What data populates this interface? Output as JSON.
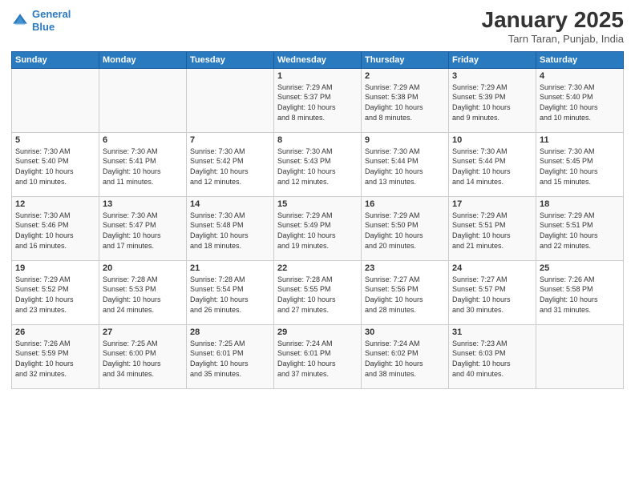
{
  "logo": {
    "line1": "General",
    "line2": "Blue"
  },
  "title": "January 2025",
  "subtitle": "Tarn Taran, Punjab, India",
  "headers": [
    "Sunday",
    "Monday",
    "Tuesday",
    "Wednesday",
    "Thursday",
    "Friday",
    "Saturday"
  ],
  "rows": [
    [
      {
        "day": "",
        "info": ""
      },
      {
        "day": "",
        "info": ""
      },
      {
        "day": "",
        "info": ""
      },
      {
        "day": "1",
        "info": "Sunrise: 7:29 AM\nSunset: 5:37 PM\nDaylight: 10 hours\nand 8 minutes."
      },
      {
        "day": "2",
        "info": "Sunrise: 7:29 AM\nSunset: 5:38 PM\nDaylight: 10 hours\nand 8 minutes."
      },
      {
        "day": "3",
        "info": "Sunrise: 7:29 AM\nSunset: 5:39 PM\nDaylight: 10 hours\nand 9 minutes."
      },
      {
        "day": "4",
        "info": "Sunrise: 7:30 AM\nSunset: 5:40 PM\nDaylight: 10 hours\nand 10 minutes."
      }
    ],
    [
      {
        "day": "5",
        "info": "Sunrise: 7:30 AM\nSunset: 5:40 PM\nDaylight: 10 hours\nand 10 minutes."
      },
      {
        "day": "6",
        "info": "Sunrise: 7:30 AM\nSunset: 5:41 PM\nDaylight: 10 hours\nand 11 minutes."
      },
      {
        "day": "7",
        "info": "Sunrise: 7:30 AM\nSunset: 5:42 PM\nDaylight: 10 hours\nand 12 minutes."
      },
      {
        "day": "8",
        "info": "Sunrise: 7:30 AM\nSunset: 5:43 PM\nDaylight: 10 hours\nand 12 minutes."
      },
      {
        "day": "9",
        "info": "Sunrise: 7:30 AM\nSunset: 5:44 PM\nDaylight: 10 hours\nand 13 minutes."
      },
      {
        "day": "10",
        "info": "Sunrise: 7:30 AM\nSunset: 5:44 PM\nDaylight: 10 hours\nand 14 minutes."
      },
      {
        "day": "11",
        "info": "Sunrise: 7:30 AM\nSunset: 5:45 PM\nDaylight: 10 hours\nand 15 minutes."
      }
    ],
    [
      {
        "day": "12",
        "info": "Sunrise: 7:30 AM\nSunset: 5:46 PM\nDaylight: 10 hours\nand 16 minutes."
      },
      {
        "day": "13",
        "info": "Sunrise: 7:30 AM\nSunset: 5:47 PM\nDaylight: 10 hours\nand 17 minutes."
      },
      {
        "day": "14",
        "info": "Sunrise: 7:30 AM\nSunset: 5:48 PM\nDaylight: 10 hours\nand 18 minutes."
      },
      {
        "day": "15",
        "info": "Sunrise: 7:29 AM\nSunset: 5:49 PM\nDaylight: 10 hours\nand 19 minutes."
      },
      {
        "day": "16",
        "info": "Sunrise: 7:29 AM\nSunset: 5:50 PM\nDaylight: 10 hours\nand 20 minutes."
      },
      {
        "day": "17",
        "info": "Sunrise: 7:29 AM\nSunset: 5:51 PM\nDaylight: 10 hours\nand 21 minutes."
      },
      {
        "day": "18",
        "info": "Sunrise: 7:29 AM\nSunset: 5:51 PM\nDaylight: 10 hours\nand 22 minutes."
      }
    ],
    [
      {
        "day": "19",
        "info": "Sunrise: 7:29 AM\nSunset: 5:52 PM\nDaylight: 10 hours\nand 23 minutes."
      },
      {
        "day": "20",
        "info": "Sunrise: 7:28 AM\nSunset: 5:53 PM\nDaylight: 10 hours\nand 24 minutes."
      },
      {
        "day": "21",
        "info": "Sunrise: 7:28 AM\nSunset: 5:54 PM\nDaylight: 10 hours\nand 26 minutes."
      },
      {
        "day": "22",
        "info": "Sunrise: 7:28 AM\nSunset: 5:55 PM\nDaylight: 10 hours\nand 27 minutes."
      },
      {
        "day": "23",
        "info": "Sunrise: 7:27 AM\nSunset: 5:56 PM\nDaylight: 10 hours\nand 28 minutes."
      },
      {
        "day": "24",
        "info": "Sunrise: 7:27 AM\nSunset: 5:57 PM\nDaylight: 10 hours\nand 30 minutes."
      },
      {
        "day": "25",
        "info": "Sunrise: 7:26 AM\nSunset: 5:58 PM\nDaylight: 10 hours\nand 31 minutes."
      }
    ],
    [
      {
        "day": "26",
        "info": "Sunrise: 7:26 AM\nSunset: 5:59 PM\nDaylight: 10 hours\nand 32 minutes."
      },
      {
        "day": "27",
        "info": "Sunrise: 7:25 AM\nSunset: 6:00 PM\nDaylight: 10 hours\nand 34 minutes."
      },
      {
        "day": "28",
        "info": "Sunrise: 7:25 AM\nSunset: 6:01 PM\nDaylight: 10 hours\nand 35 minutes."
      },
      {
        "day": "29",
        "info": "Sunrise: 7:24 AM\nSunset: 6:01 PM\nDaylight: 10 hours\nand 37 minutes."
      },
      {
        "day": "30",
        "info": "Sunrise: 7:24 AM\nSunset: 6:02 PM\nDaylight: 10 hours\nand 38 minutes."
      },
      {
        "day": "31",
        "info": "Sunrise: 7:23 AM\nSunset: 6:03 PM\nDaylight: 10 hours\nand 40 minutes."
      },
      {
        "day": "",
        "info": ""
      }
    ]
  ]
}
